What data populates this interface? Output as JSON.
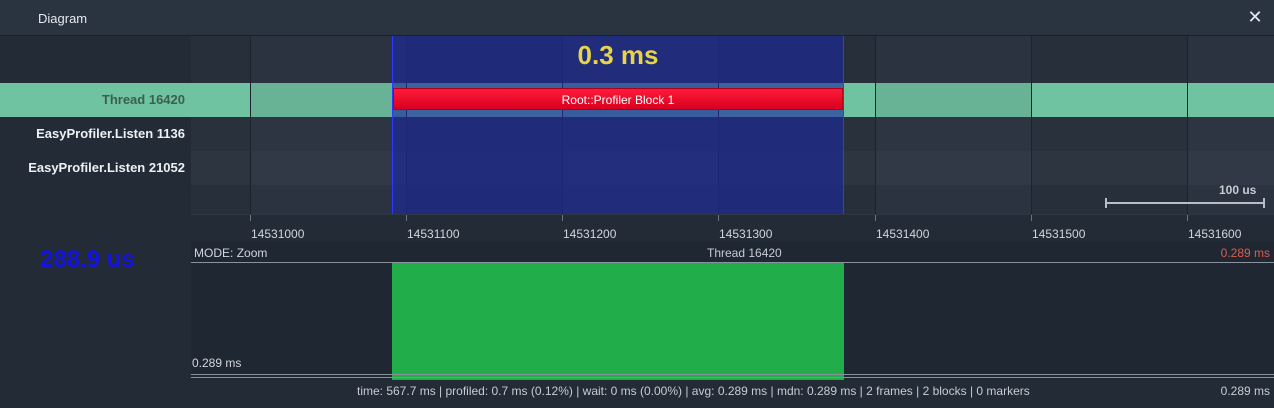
{
  "window": {
    "title": "Diagram",
    "close_glyph": "✕"
  },
  "threads": [
    {
      "label": "Thread 16420",
      "color": "#6fc3a0",
      "text_color": "#3a5e50"
    },
    {
      "label": "EasyProfiler.Listen 1136",
      "color": "#262f3a",
      "text_color": "#eef0f3"
    },
    {
      "label": "EasyProfiler.Listen 21052",
      "color": "#2b3440",
      "text_color": "#eef0f3"
    }
  ],
  "selection": {
    "duration_label": "0.3 ms"
  },
  "block": {
    "label": "Root::Profiler Block 1",
    "color": "#e8001f"
  },
  "scale": {
    "label": "100 us"
  },
  "ruler": {
    "ticks": [
      "14531000",
      "14531100",
      "14531200",
      "14531300",
      "14531400",
      "14531500",
      "14531600"
    ]
  },
  "left": {
    "selected_duration": "288.9 us"
  },
  "histogram": {
    "mode_key": "MODE:",
    "mode_value": "Zoom",
    "thread": "Thread 16420",
    "max_label": "0.289 ms",
    "min_label": "0.289 ms",
    "bar_color": "#21ad4a"
  },
  "footer": {
    "stats": "time: 567.7 ms | profiled: 0.7 ms (0.12%) | wait: 0 ms (0.00%) | avg: 0.289 ms | mdn: 0.289 ms | 2 frames | 2 blocks | 0 markers",
    "right": "0.289 ms"
  },
  "icons": {
    "close": "close-icon"
  }
}
